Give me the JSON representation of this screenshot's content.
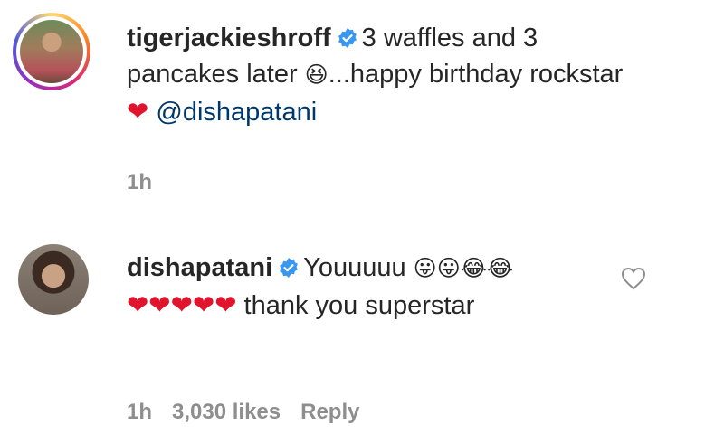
{
  "comments": [
    {
      "username": "tigerjackieshroff",
      "text_part1": "3 waffles and 3 pancakes later ",
      "emoji1": "😆",
      "text_part2": "...happy birthday rockstar",
      "heart": "❤",
      "mention": "@dishapatani",
      "time": "1h"
    },
    {
      "username": "dishapatani",
      "text_part1": "Youuuuu ",
      "emojis": "😛😛😂😂",
      "line2_prefix": "",
      "hearts": "❤❤❤❤❤",
      "line2_suffix": " thank you superstar ",
      "line2_tail": "",
      "time": "1h",
      "likes": "3,030 likes",
      "reply_label": "Reply"
    }
  ],
  "colors": {
    "verified": "#3897f0",
    "mention": "#00376b",
    "meta": "#8e8e8e",
    "heart": "#e0142d"
  },
  "icons": {
    "verified": "verified-badge-icon",
    "like": "heart-outline-icon"
  }
}
